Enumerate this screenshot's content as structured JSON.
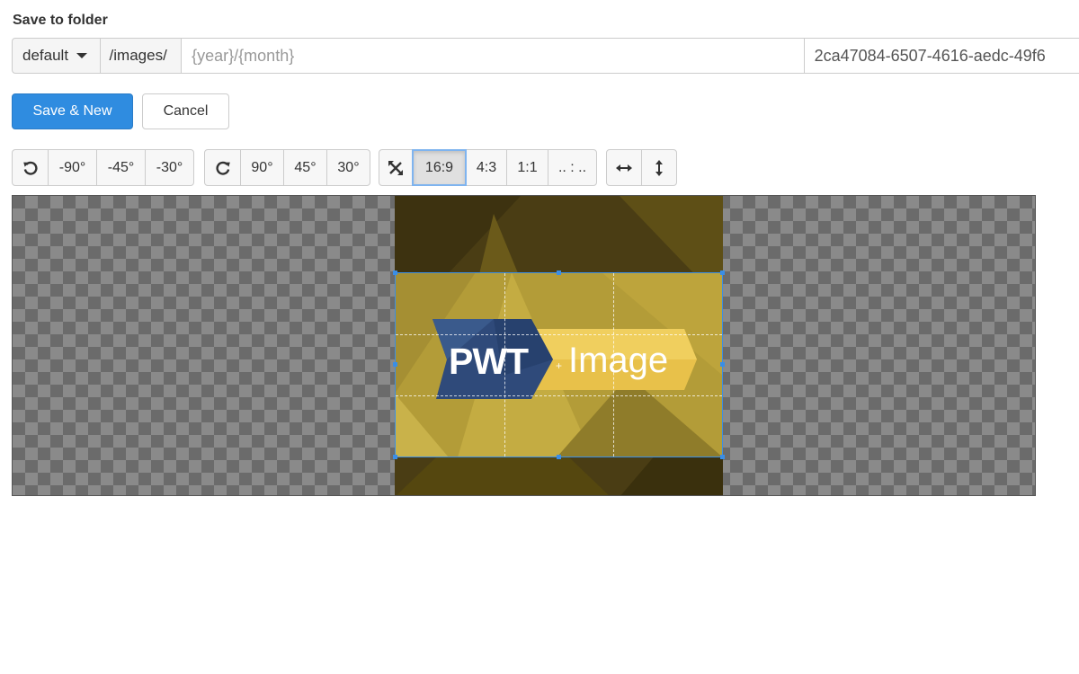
{
  "form": {
    "title": "Save to folder",
    "folder_select": {
      "selected": "default"
    },
    "base_path": "/images/",
    "subfolder_input": {
      "value": "",
      "placeholder": "{year}/{month}"
    },
    "filename_input": {
      "value": "2ca47084-6507-4616-aedc-49f6"
    }
  },
  "actions": {
    "save_new_label": "Save & New",
    "cancel_label": "Cancel"
  },
  "toolbar": {
    "rotate_left": {
      "icon": "rotate-left-icon",
      "options": [
        "-90°",
        "-45°",
        "-30°"
      ]
    },
    "rotate_right": {
      "icon": "rotate-right-icon",
      "options": [
        "90°",
        "45°",
        "30°"
      ]
    },
    "aspect_ratio": {
      "icon": "crop-free-icon",
      "options": [
        "16:9",
        "4:3",
        "1:1",
        ".. : .."
      ],
      "active": "16:9"
    },
    "flip": {
      "horizontal_icon": "flip-horizontal-icon",
      "vertical_icon": "flip-vertical-icon"
    }
  },
  "image": {
    "logo_left": "PWT",
    "logo_right": "Image"
  },
  "colors": {
    "primary": "#2f8ce0",
    "crop_border": "#3a8ee6",
    "logo_blue": "#2f4a7a",
    "logo_yellow": "#e8c14a"
  }
}
